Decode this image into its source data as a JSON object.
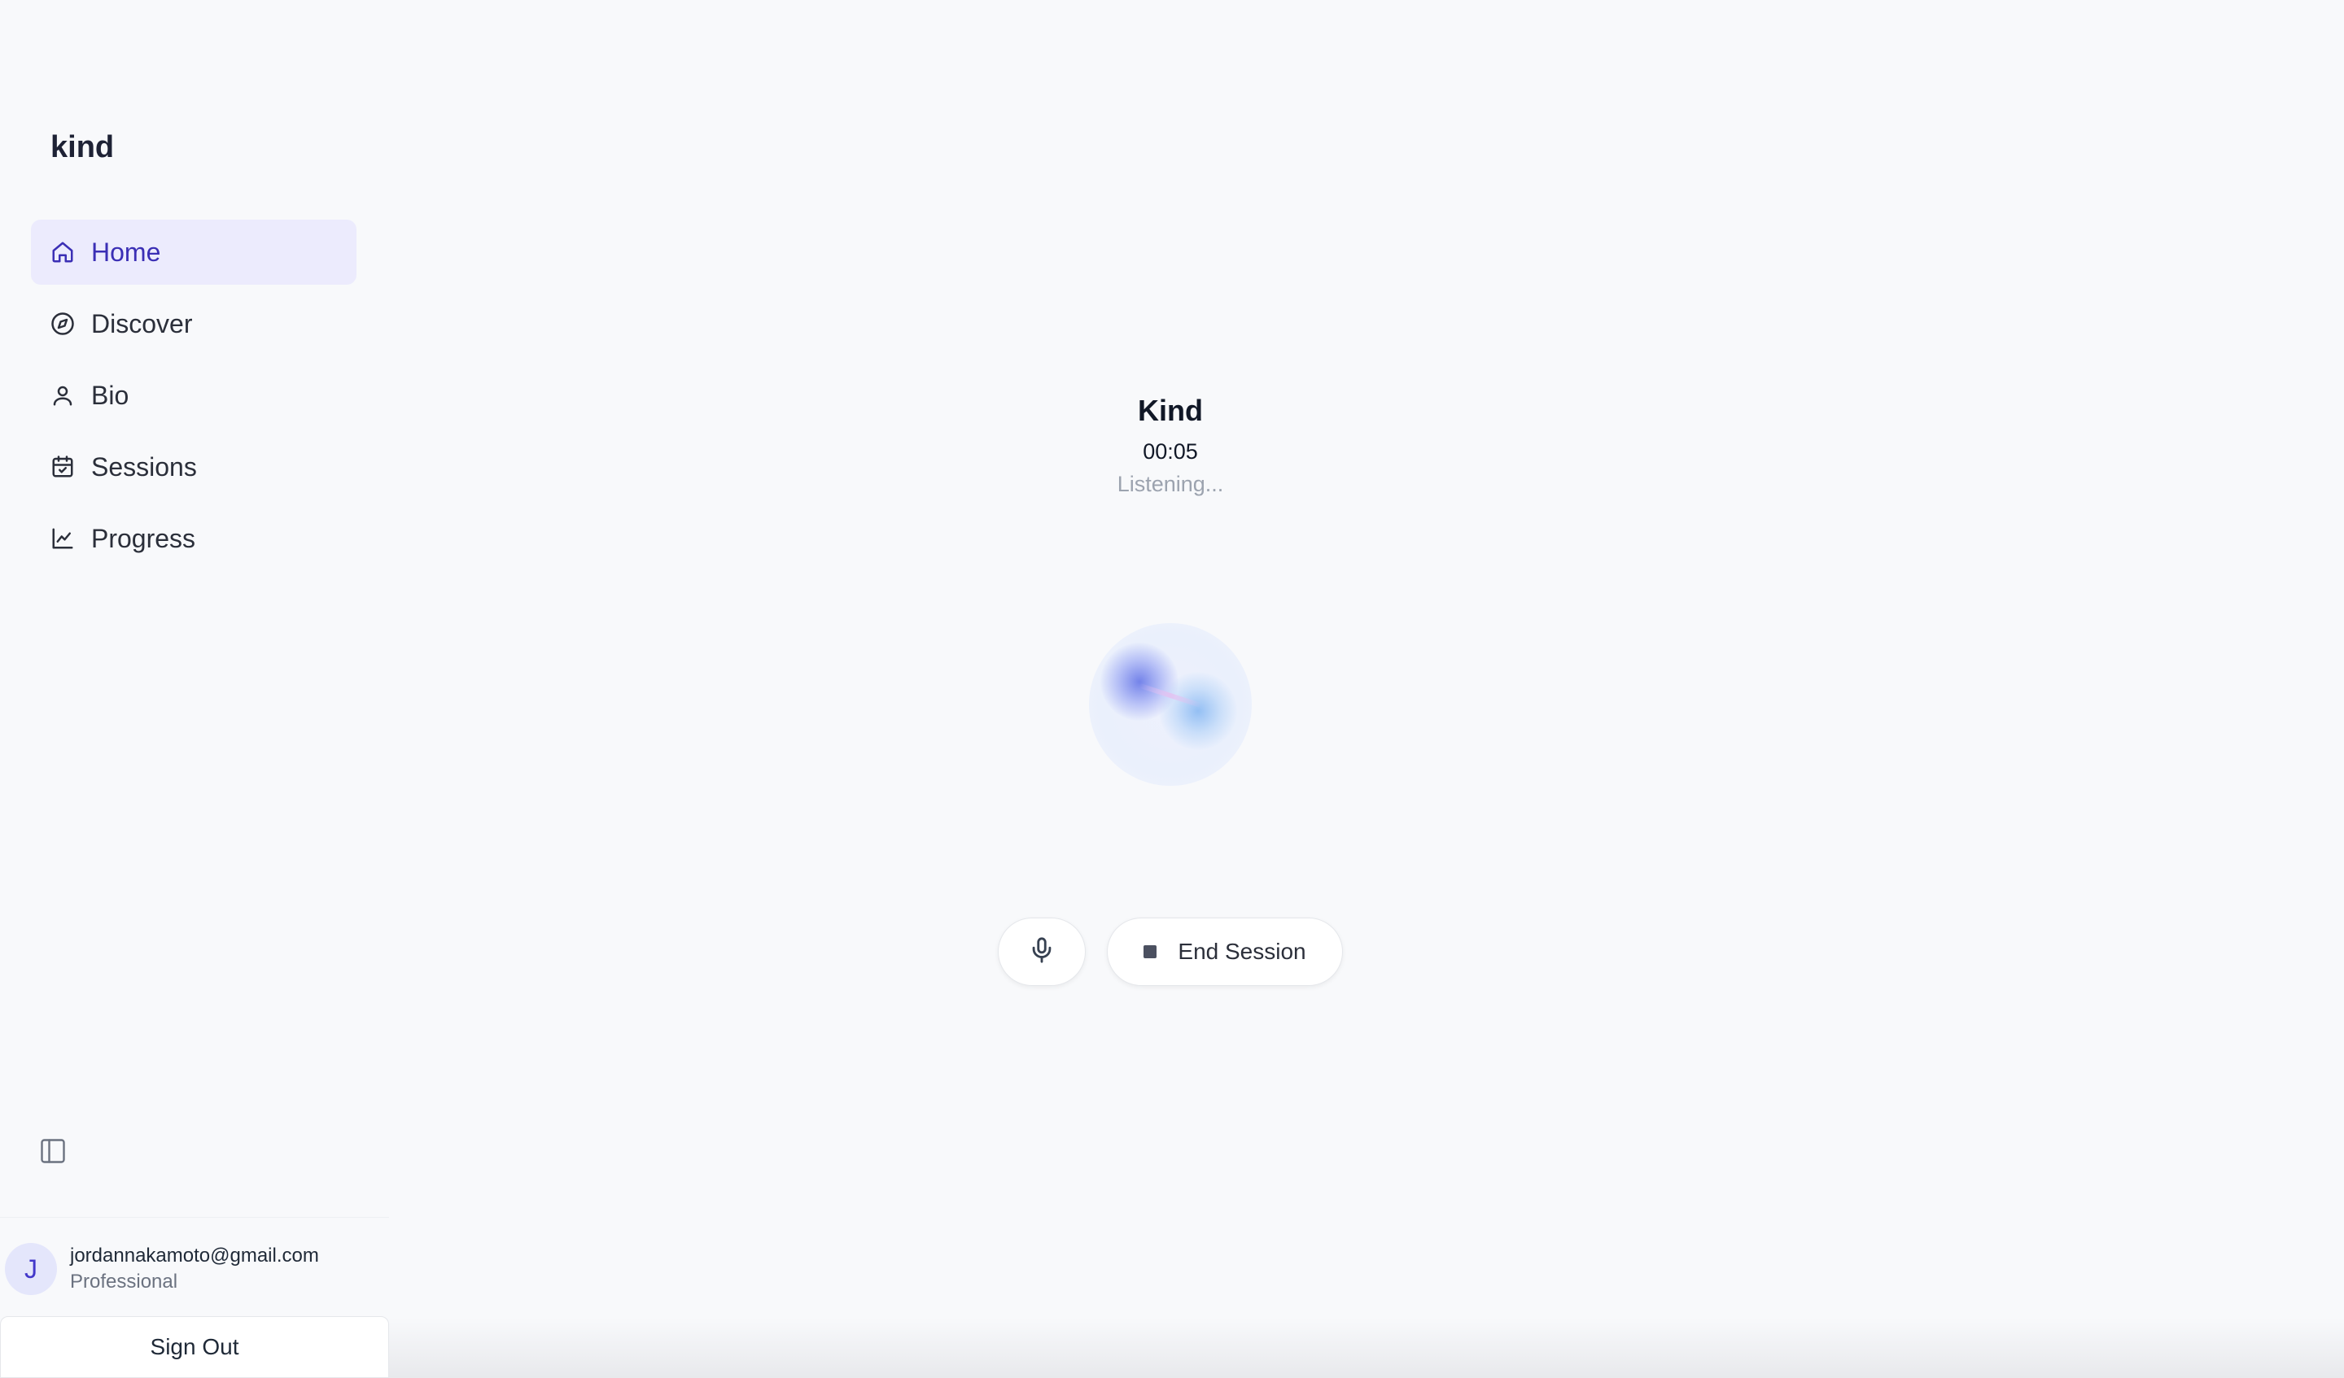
{
  "brand": "kind",
  "nav": [
    {
      "label": "Home",
      "icon": "home-icon",
      "active": true
    },
    {
      "label": "Discover",
      "icon": "compass-icon",
      "active": false
    },
    {
      "label": "Bio",
      "icon": "user-icon",
      "active": false
    },
    {
      "label": "Sessions",
      "icon": "calendar-check-icon",
      "active": false
    },
    {
      "label": "Progress",
      "icon": "line-chart-icon",
      "active": false
    }
  ],
  "user": {
    "initial": "J",
    "email": "jordannakamoto@gmail.com",
    "plan": "Professional"
  },
  "sign_out_label": "Sign Out",
  "session": {
    "title": "Kind",
    "timer": "00:05",
    "status": "Listening..."
  },
  "controls": {
    "end_session_label": "End Session"
  },
  "colors": {
    "accent": "#3b2fb5",
    "active_bg": "#ecebfd",
    "background": "#f8f9fb"
  }
}
